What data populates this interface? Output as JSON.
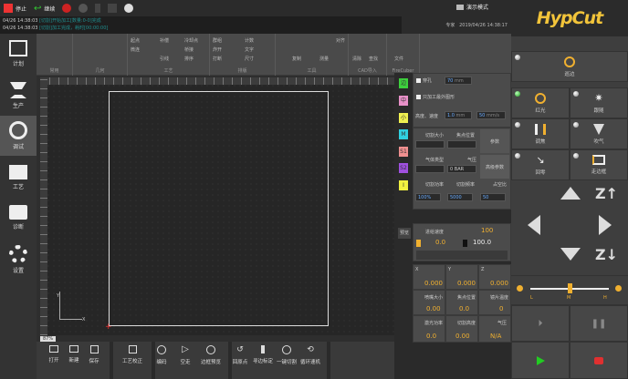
{
  "topbar": {
    "stop": "停止",
    "breakpoint": "继续"
  },
  "demo_mode": "演示模式",
  "log": [
    {
      "time": "04/26 14:38:03",
      "msg": "[切割]开始加工[数量:0-0]完成"
    },
    {
      "time": "04/26 14:38:03",
      "msg": "[切割]加工完成，耗时[00:00:00]"
    }
  ],
  "status": {
    "mode": "专家",
    "datetime": "2019/04/26 14:38:17"
  },
  "ribbon": {
    "groups": [
      "常用",
      "几何",
      "工艺",
      "排版",
      "工具",
      "CAD导入",
      "FireCuber"
    ],
    "items": [
      "起点",
      "微连",
      "冷却点",
      "补偿",
      "阵列",
      "引线",
      "桥接",
      "排序",
      "群组",
      "炸开",
      "打断",
      "计数",
      "尺寸",
      "圆角",
      "曲线",
      "文字",
      "测量",
      "镜像",
      "复制",
      "接刀",
      "对齐",
      "排刀",
      "清除",
      "查找",
      "变换",
      "缩放",
      "重心",
      "CAD导入",
      "文件"
    ]
  },
  "sidebar": [
    {
      "label": "计划"
    },
    {
      "label": "生产"
    },
    {
      "label": "调试"
    },
    {
      "label": "工艺"
    },
    {
      "label": "诊断"
    },
    {
      "label": "设置"
    }
  ],
  "canvas": {
    "zoom": "87%",
    "axis_y": "Y",
    "axis_x": "X"
  },
  "bottom": [
    "打开",
    "新建",
    "保存",
    "工艺校正",
    "编码",
    "空走",
    "边框预览",
    "回原点",
    "寻边标定",
    "一键切割",
    "循环速机"
  ],
  "layers": [
    {
      "label": "边",
      "color": "#3dd13d"
    },
    {
      "label": "中",
      "color": "#e890c8"
    },
    {
      "label": "小",
      "color": "#f0f050"
    },
    {
      "label": "M",
      "color": "#30d0e0"
    },
    {
      "label": "S1",
      "color": "#f09090"
    },
    {
      "label": "S2",
      "color": "#a050e0"
    },
    {
      "label": "I",
      "color": "#f0f040"
    }
  ],
  "params": {
    "pierce": "穿孔",
    "pierce_val": "70",
    "unit_mm": "mm",
    "only_outline": "只加工最外图形",
    "height_speed": "高度、速度",
    "h_val": "1.0",
    "speed_val": "50",
    "unit_mms": "mm/s",
    "nozzle": "切割大小",
    "focus": "焦点位置",
    "detail": "参数",
    "gas_type": "气体类型",
    "gas": "气压",
    "gas_val": "0",
    "gas_unit": "BAR",
    "adv": "高级参数",
    "power": "切割功率",
    "freq": "切割频率",
    "duty": "占空比",
    "power_val": "100%",
    "freq_val": "5000",
    "duty_val": "50"
  },
  "preview_tab": "预览",
  "speed": {
    "label": "进给速度",
    "value": "100",
    "left": "0.0",
    "right": "100.0"
  },
  "coords": {
    "x_label": "X",
    "y_label": "Y",
    "z_label": "Z",
    "x": "0.000",
    "y": "0.000",
    "z": "0.000",
    "unit": "mm"
  },
  "readouts": [
    {
      "label": "喷嘴大小",
      "value": "0.00"
    },
    {
      "label": "焦点位置",
      "value": "0.0"
    },
    {
      "label": "镜片温度",
      "value": "0"
    },
    {
      "label": "激光功率",
      "value": "0.0"
    },
    {
      "label": "切割高度",
      "value": "0.00"
    },
    {
      "label": "气压",
      "value": "N/A"
    }
  ],
  "right": {
    "logo": "HypCut",
    "buttons": [
      {
        "label": "巡边"
      },
      {
        "label": "红光"
      },
      {
        "label": "跟随"
      },
      {
        "label": "调焦"
      },
      {
        "label": "吹气"
      },
      {
        "label": "回零"
      },
      {
        "label": "走边框"
      }
    ],
    "slider": {
      "labels": [
        "L",
        "M",
        "H"
      ],
      "value": 0.5
    },
    "z_up": "Z↑",
    "z_down": "Z↓"
  },
  "colors": {
    "accent": "#f0b030",
    "stop": "#e03030",
    "start": "#22cc22"
  }
}
